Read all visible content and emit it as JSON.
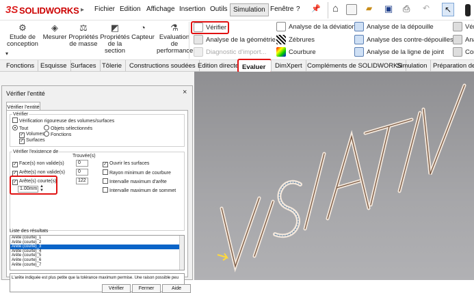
{
  "app": {
    "logo_brand": "SOLIDWORKS",
    "logo_prefix": "3S"
  },
  "menubar": {
    "items": [
      "Fichier",
      "Edition",
      "Affichage",
      "Insertion",
      "Outils",
      "Simulation",
      "Fenêtre",
      "?"
    ],
    "active": "Simulation"
  },
  "ribbon": {
    "left_tools": [
      {
        "label": "Etude de conception",
        "icon": "design-study-icon"
      },
      {
        "label": "Mesurer",
        "icon": "measure-icon"
      },
      {
        "label": "Propriétés de masse",
        "icon": "mass-properties-icon"
      },
      {
        "label": "Propriétés de la section",
        "icon": "section-properties-icon"
      },
      {
        "label": "Capteur",
        "icon": "sensor-icon"
      },
      {
        "label": "Evaluation de performance",
        "icon": "performance-evaluation-icon"
      }
    ],
    "col2": [
      "Vérifier",
      "Analyse de la géométrie",
      "Diagnostic d'import..."
    ],
    "col3": [
      "Analyse de la déviation",
      "Zébrures",
      "Courbure"
    ],
    "col4": [
      "Analyse de la dépouille",
      "Analyse des contre-dépouilles",
      "Analyse de la ligne de joint"
    ],
    "col5": [
      "Véri",
      "Ana",
      "Com"
    ]
  },
  "tabs": [
    "Fonctions",
    "Esquisse",
    "Surfaces",
    "Tôlerie",
    "Constructions soudées",
    "Edition directe",
    "Evaluer",
    "DimXpert",
    "Compléments de SOLIDWORKS",
    "Simulation",
    "Préparation de"
  ],
  "dialog": {
    "title": "Vérifier l'entité",
    "close": "×",
    "tab": "Vérifier l'entité",
    "verifier_group": "Vérifier",
    "rigorous": "Vérification rigoureuse des volumes/surfaces",
    "radio_all": "Tout",
    "radio_selected": "Objets sélectionnés",
    "cb_volumes": "Volumes",
    "radio_functions": "Fonctions",
    "cb_surfaces": "Surfaces",
    "existence_group": "Vérifier l'existence de",
    "found_header": "Trouvée(s)",
    "faces": "Face(s) non valide(s)",
    "faces_found": "0",
    "edges_invalid": "Arête(s) non valide(s)",
    "edges_invalid_found": "0",
    "short_edges": "Arête(s) courte(s)",
    "short_edges_found": "122",
    "tolerance": "1.00mm",
    "open_surfaces": "Ouvrir les surfaces",
    "min_radius": "Rayon minimum de courbure",
    "max_edge": "Intervalle maximum d'arête",
    "max_vertex": "Intervalle maximum de sommet",
    "results_label": "Liste des résultats",
    "results": [
      "Arête (courte)_1",
      "Arête (courte)_2",
      "Arête (courte)_3",
      "Arête (courte)_4",
      "Arête (courte)_5",
      "Arête (courte)_6",
      "Arête (courte)_7"
    ],
    "selected_result": 2,
    "note": "L'arête indiquée est plus petite que la tolérance maximum permise. Une raison possible peu",
    "btn_verify": "Vérifier",
    "btn_close": "Fermer",
    "btn_help": "Aide"
  },
  "viewport": {
    "text": "VISIATIV",
    "accent": "#ffd93a"
  },
  "colors": {
    "highlight": "#e01010",
    "selection": "#0a64c8"
  }
}
